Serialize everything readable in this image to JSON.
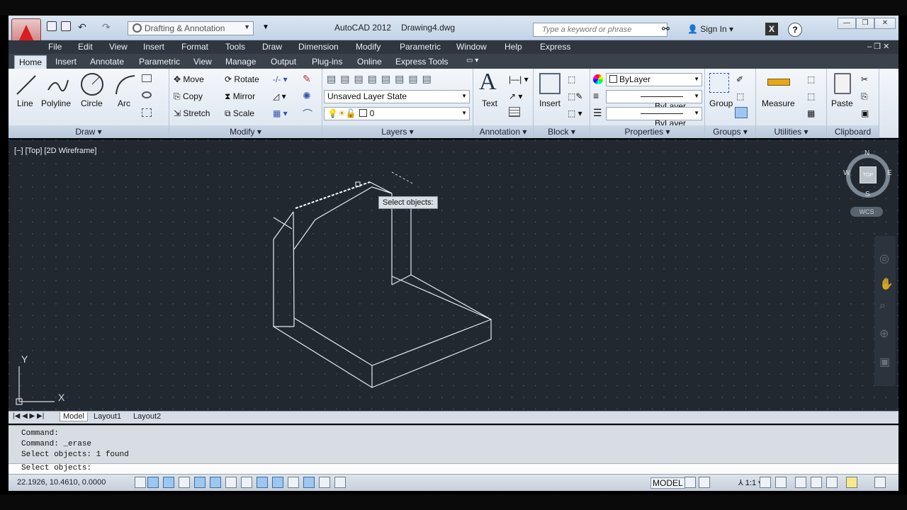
{
  "title_bar": {
    "app_name": "AutoCAD 2012",
    "file_name": "Drawing4.dwg",
    "workspace": "Drafting & Annotation",
    "search_placeholder": "Type a keyword or phrase",
    "sign_in": "Sign In",
    "help_label": "?"
  },
  "menu": [
    "File",
    "Edit",
    "View",
    "Insert",
    "Format",
    "Tools",
    "Draw",
    "Dimension",
    "Modify",
    "Parametric",
    "Window",
    "Help",
    "Express"
  ],
  "tabs": [
    "Home",
    "Insert",
    "Annotate",
    "Parametric",
    "View",
    "Manage",
    "Output",
    "Plug-ins",
    "Online",
    "Express Tools"
  ],
  "active_tab": "Home",
  "ribbon": {
    "draw": {
      "title": "Draw",
      "line": "Line",
      "polyline": "Polyline",
      "circle": "Circle",
      "arc": "Arc"
    },
    "modify": {
      "title": "Modify",
      "move": "Move",
      "rotate": "Rotate",
      "copy": "Copy",
      "mirror": "Mirror",
      "stretch": "Stretch",
      "scale": "Scale"
    },
    "layers": {
      "title": "Layers",
      "layer_state": "Unsaved Layer State",
      "current_layer": "0"
    },
    "annotation": {
      "title": "Annotation",
      "text": "Text"
    },
    "block": {
      "title": "Block",
      "insert": "Insert"
    },
    "properties": {
      "title": "Properties",
      "color": "ByLayer",
      "linetype": "ByLayer",
      "lineweight": "ByLayer"
    },
    "groups": {
      "title": "Groups",
      "group": "Group"
    },
    "utilities": {
      "title": "Utilities",
      "measure": "Measure"
    },
    "clipboard": {
      "title": "Clipboard",
      "paste": "Paste"
    }
  },
  "viewport": {
    "label": "[−] [Top] [2D Wireframe]",
    "tooltip": "Select objects:",
    "viewcube": {
      "n": "N",
      "s": "S",
      "e": "E",
      "w": "W",
      "face": "TOP",
      "wcs": "WCS"
    },
    "ucs": {
      "x": "X",
      "y": "Y"
    }
  },
  "layout_tabs": [
    "Model",
    "Layout1",
    "Layout2"
  ],
  "command_history": [
    "Command:",
    "Command: _erase",
    "Select objects: 1 found"
  ],
  "command_prompt": "Select objects:",
  "status": {
    "coordinates": "22.1926, 10.4610, 0.0000",
    "model": "MODEL",
    "annotation_scale": "1:1"
  },
  "colors": {
    "viewport_bg": "#212830",
    "ribbon_bg": "#e6edf5",
    "accent": "#d81e1e"
  }
}
